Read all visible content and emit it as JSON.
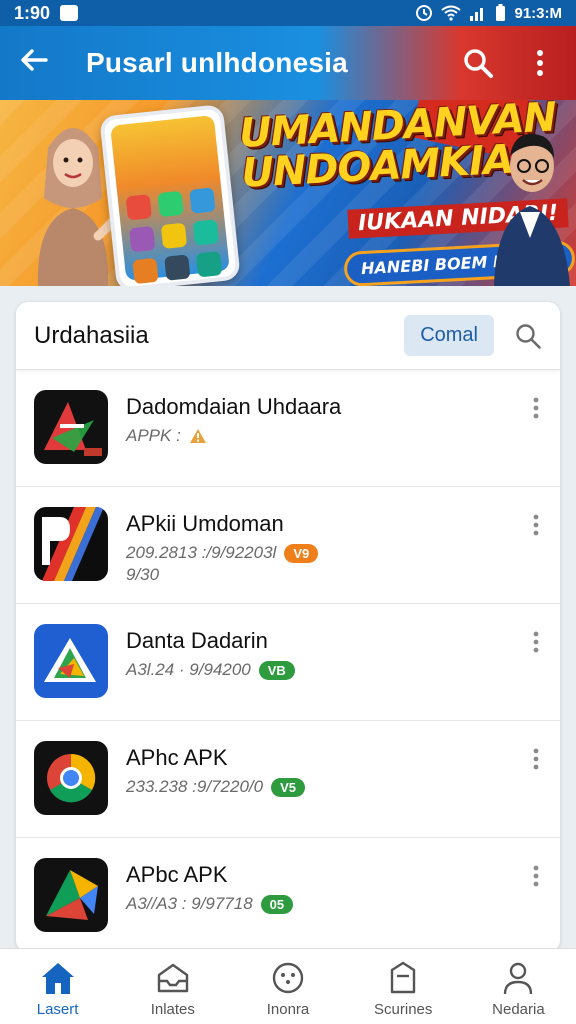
{
  "status_bar": {
    "time_left": "1:90",
    "time_right": "91:3:M"
  },
  "app_bar": {
    "title": "Pusarl unlhdonesia",
    "back_icon": "arrow-left-icon",
    "search_icon": "search-icon",
    "menu_icon": "more-vert-icon"
  },
  "banner": {
    "headline": "UMANDANVAN UNDOAMKIAS",
    "subtitle": "IUKAAN NIDARI!",
    "cta": "HANEBI BOEM I/NIJAM"
  },
  "search": {
    "query": "Urdahasiia",
    "chip_label": "Comal"
  },
  "apps": [
    {
      "title": "Dadomdaian Uhdaara",
      "meta": "APPK :",
      "meta2": "",
      "badge": "",
      "badge_color": ""
    },
    {
      "title": "APkii Umdoman",
      "meta": "209.2813 :/9/92203l",
      "meta2": "9/30",
      "badge": "V9",
      "badge_color": "#ef7f1a"
    },
    {
      "title": "Danta Dadarin",
      "meta": "A3l.24 · 9/94200",
      "meta2": "",
      "badge": "VB",
      "badge_color": "#2e9b3e"
    },
    {
      "title": "APhc APK",
      "meta": "233.238 :9/7220/0",
      "meta2": "",
      "badge": "V5",
      "badge_color": "#2e9b3e"
    },
    {
      "title": "APbc APK",
      "meta": "A3//A3 : 9/97718",
      "meta2": "",
      "badge": "05",
      "badge_color": "#2e9b3e"
    }
  ],
  "bottom_nav": [
    {
      "label": "Lasert",
      "icon": "home-icon",
      "active": true
    },
    {
      "label": "Inlates",
      "icon": "inbox-icon",
      "active": false
    },
    {
      "label": "Inonra",
      "icon": "chat-icon",
      "active": false
    },
    {
      "label": "Scurines",
      "icon": "tag-icon",
      "active": false
    },
    {
      "label": "Nedaria",
      "icon": "person-icon",
      "active": false
    }
  ],
  "colors": {
    "primary": "#1478c8",
    "accent_red": "#d52b1e",
    "active_nav": "#1565c0"
  }
}
